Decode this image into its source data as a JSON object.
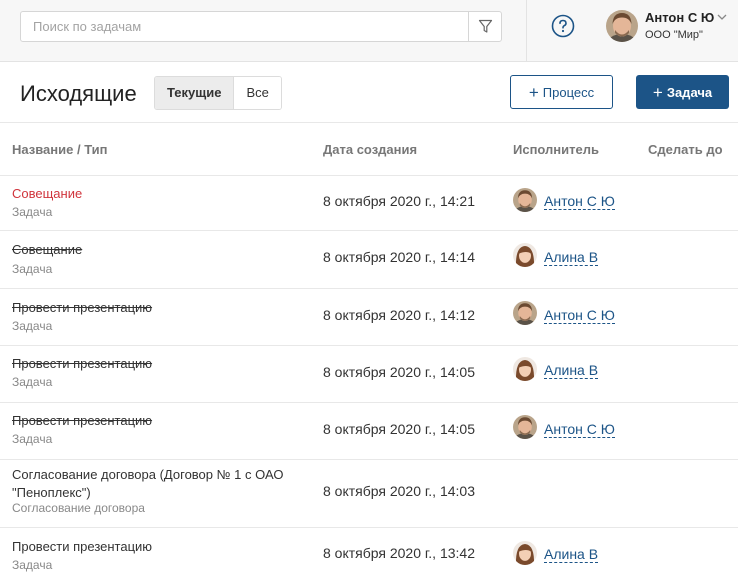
{
  "header": {
    "search_placeholder": "Поиск по задачам",
    "user_name": "Антон С Ю",
    "org": "ООО \"Мир\""
  },
  "toolbar": {
    "title": "Исходящие",
    "tabs": [
      "Текущие",
      "Все"
    ],
    "process_label": "Процесс",
    "task_label": "Задача"
  },
  "table": {
    "columns": [
      "Название / Тип",
      "Дата создания",
      "Исполнитель",
      "Сделать до"
    ],
    "rows": [
      {
        "name": "Совещание",
        "type": "Задача",
        "date": "8 октября 2020 г., 14:21",
        "assignee": "Антон С Ю"
      },
      {
        "name": "Совещание",
        "type": "Задача",
        "date": "8 октября 2020 г., 14:14",
        "assignee": "Алина В"
      },
      {
        "name": "Провести презентацию",
        "type": "Задача",
        "date": "8 октября 2020 г., 14:12",
        "assignee": "Антон С Ю"
      },
      {
        "name": "Провести презентацию",
        "type": "Задача",
        "date": "8 октября 2020 г., 14:05",
        "assignee": "Алина В"
      },
      {
        "name": "Провести презентацию",
        "type": "Задача",
        "date": "8 октября 2020 г., 14:05",
        "assignee": "Антон С Ю"
      },
      {
        "name": "Согласование договора (Договор № 1 с ОАО \"Пеноплекс\")",
        "type": "Согласование договора",
        "date": "8 октября 2020 г., 14:03",
        "assignee": ""
      },
      {
        "name": "Провести презентацию",
        "type": "Задача",
        "date": "8 октября 2020 г., 13:42",
        "assignee": "Алина В"
      }
    ]
  },
  "colors": {
    "accent": "#1c5487",
    "overdue": "#d0343c"
  }
}
